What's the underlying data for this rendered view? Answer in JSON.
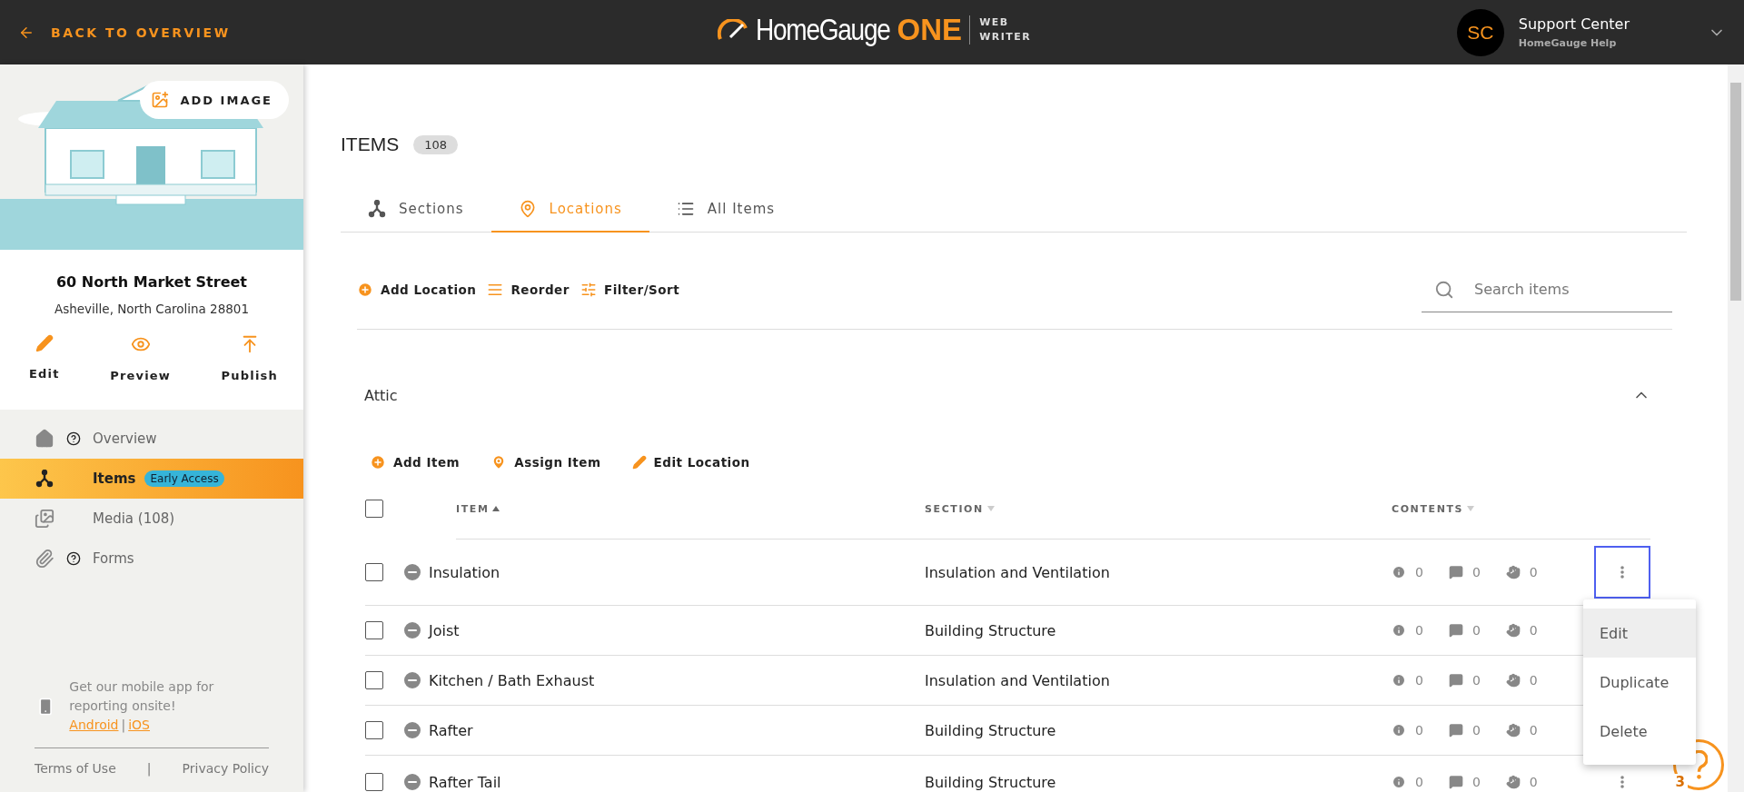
{
  "header": {
    "back_link": "BACK TO OVERVIEW",
    "logo": {
      "brand": "HomeGauge",
      "accent": "ONE",
      "sub_1": "WEB",
      "sub_2": "WRITER"
    },
    "user": {
      "initials": "SC",
      "name": "Support Center",
      "subtitle": "HomeGauge Help"
    }
  },
  "sidebar": {
    "add_image": "ADD IMAGE",
    "address": {
      "street": "60 North Market Street",
      "city": "Asheville,  North Carolina 28801"
    },
    "actions": [
      {
        "label": "Edit",
        "kind": "edit"
      },
      {
        "label": "Preview",
        "kind": "preview"
      },
      {
        "label": "Publish",
        "kind": "publish"
      }
    ],
    "nav": [
      {
        "label": "Overview",
        "kind": "home",
        "help": true,
        "selected": false
      },
      {
        "label": "Items",
        "kind": "tree",
        "help": false,
        "badge": "Early Access",
        "selected": true
      },
      {
        "label": "Media (108)",
        "kind": "media",
        "help": false,
        "selected": false
      },
      {
        "label": "Forms",
        "kind": "clip",
        "help": true,
        "selected": false
      }
    ],
    "app_promo": {
      "text": "Get our mobile app for reporting onsite!",
      "links": [
        "Android",
        "iOS"
      ],
      "separator": "|"
    },
    "footer_links": [
      "Terms of Use",
      "Privacy Policy"
    ],
    "footer_separator": "|"
  },
  "main": {
    "title": "ITEMS",
    "count": "108",
    "tabs": [
      {
        "label": "Sections",
        "kind": "tree",
        "selected": false
      },
      {
        "label": "Locations",
        "kind": "pin",
        "selected": true
      },
      {
        "label": "All Items",
        "kind": "list",
        "selected": false
      }
    ],
    "toolbar": [
      {
        "label": "Add Location",
        "kind": "add"
      },
      {
        "label": "Reorder",
        "kind": "reorder"
      },
      {
        "label": "Filter/Sort",
        "kind": "filter"
      }
    ],
    "search": {
      "placeholder": "Search items"
    },
    "location": {
      "name": "Attic",
      "expanded": true
    },
    "location_actions": [
      {
        "label": "Add Item",
        "kind": "add"
      },
      {
        "label": "Assign Item",
        "kind": "pin"
      },
      {
        "label": "Edit Location",
        "kind": "edit"
      }
    ],
    "select_all": {
      "checked": false
    },
    "columns": [
      {
        "label": "ITEM",
        "sorted": true
      },
      {
        "label": "SECTION",
        "sorted": false
      },
      {
        "label": "CONTENTS",
        "sorted": false
      }
    ],
    "rows": [
      {
        "item": "Insulation",
        "section": "Insulation and Ventilation",
        "checked": false,
        "contents": [
          "0",
          "0",
          "0"
        ],
        "menu": [
          {
            "label": "Edit",
            "selected": true
          },
          {
            "label": "Duplicate",
            "selected": false
          },
          {
            "label": "Delete",
            "selected": false
          }
        ]
      },
      {
        "item": "Joist",
        "section": "Building Structure",
        "checked": false,
        "contents": [
          "0",
          "0",
          "0"
        ]
      },
      {
        "item": "Kitchen / Bath Exhaust",
        "section": "Insulation and Ventilation",
        "checked": false,
        "contents": [
          "0",
          "0",
          "0"
        ]
      },
      {
        "item": "Rafter",
        "section": "Building Structure",
        "checked": false,
        "contents": [
          "0",
          "0",
          "0"
        ]
      },
      {
        "item": "Rafter Tail",
        "section": "Building Structure",
        "checked": false,
        "contents": [
          "0",
          "0",
          "0"
        ]
      }
    ],
    "help_badge": "3"
  }
}
